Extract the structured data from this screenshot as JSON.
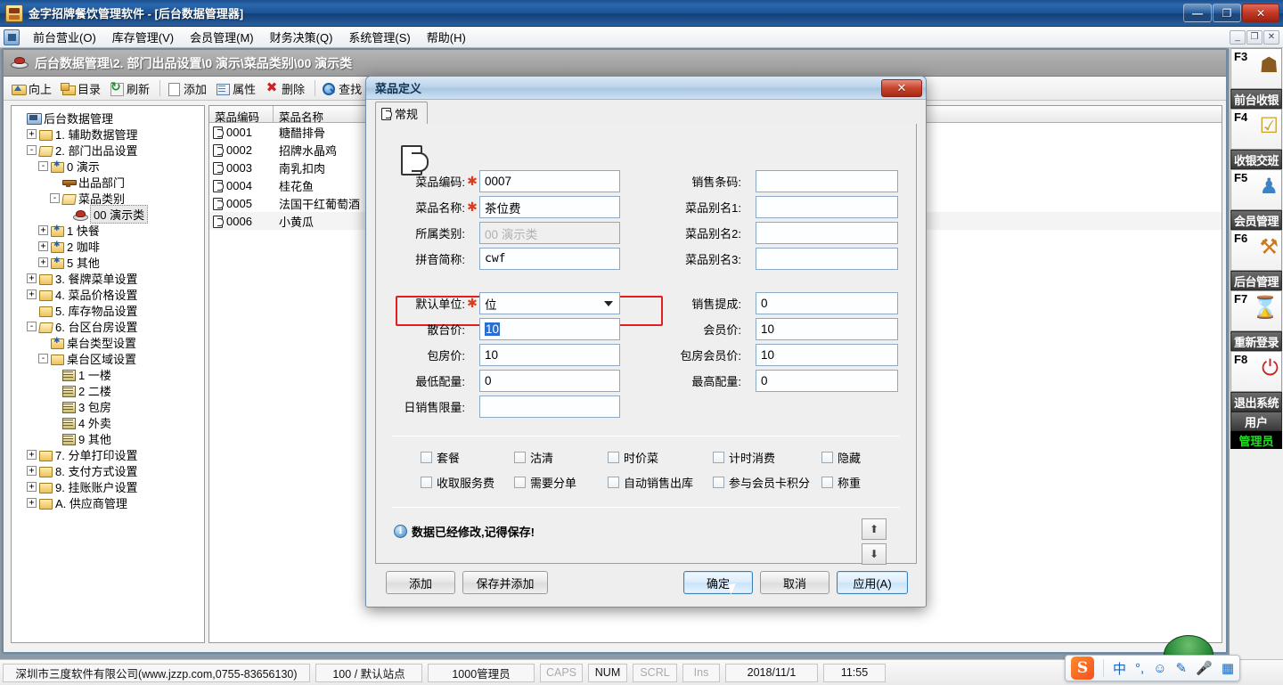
{
  "window": {
    "title": "金字招牌餐饮管理软件 - [后台数据管理器]",
    "minimize": "—",
    "maximize": "❐",
    "close": "✕",
    "mdi_minimize": "_",
    "mdi_restore": "❐",
    "mdi_close": "✕"
  },
  "menubar": {
    "items": [
      {
        "label": "前台营业(O)"
      },
      {
        "label": "库存管理(V)"
      },
      {
        "label": "会员管理(M)"
      },
      {
        "label": "财务决策(Q)"
      },
      {
        "label": "系统管理(S)"
      },
      {
        "label": "帮助(H)"
      }
    ]
  },
  "child": {
    "breadcrumb": "后台数据管理\\2. 部门出品设置\\0 演示\\菜品类别\\00 演示类",
    "toolbar": [
      {
        "label": "向上",
        "icon": "folder-up-icon"
      },
      {
        "label": "目录",
        "icon": "folder-icon"
      },
      {
        "label": "刷新",
        "icon": "refresh-icon"
      },
      {
        "label": "添加",
        "icon": "document-icon"
      },
      {
        "label": "属性",
        "icon": "properties-icon"
      },
      {
        "label": "删除",
        "icon": "delete-icon"
      },
      {
        "label": "查找",
        "icon": "search-icon"
      }
    ]
  },
  "tree": {
    "root": "后台数据管理",
    "nodes": [
      {
        "label": "1. 辅助数据管理",
        "depth": 1,
        "exp": "+",
        "icon": "folder"
      },
      {
        "label": "2. 部门出品设置",
        "depth": 1,
        "exp": "-",
        "icon": "folder-open"
      },
      {
        "label": "0 演示",
        "depth": 2,
        "exp": "-",
        "icon": "folder-star"
      },
      {
        "label": "出品部门",
        "depth": 3,
        "exp": "",
        "icon": "dept"
      },
      {
        "label": "菜品类别",
        "depth": 3,
        "exp": "-",
        "icon": "folder-open"
      },
      {
        "label": "00 演示类",
        "depth": 4,
        "exp": "",
        "icon": "dish",
        "selected": true
      },
      {
        "label": "1 快餐",
        "depth": 2,
        "exp": "+",
        "icon": "folder-star"
      },
      {
        "label": "2 咖啡",
        "depth": 2,
        "exp": "+",
        "icon": "folder-star"
      },
      {
        "label": "5 其他",
        "depth": 2,
        "exp": "+",
        "icon": "folder-star"
      },
      {
        "label": "3. 餐牌菜单设置",
        "depth": 1,
        "exp": "+",
        "icon": "folder"
      },
      {
        "label": "4. 菜品价格设置",
        "depth": 1,
        "exp": "+",
        "icon": "folder"
      },
      {
        "label": "5. 库存物品设置",
        "depth": 1,
        "exp": "",
        "icon": "folder"
      },
      {
        "label": "6. 台区台房设置",
        "depth": 1,
        "exp": "-",
        "icon": "folder-open"
      },
      {
        "label": "桌台类型设置",
        "depth": 2,
        "exp": "",
        "icon": "folder-star"
      },
      {
        "label": "桌台区域设置",
        "depth": 2,
        "exp": "-",
        "icon": "folder"
      },
      {
        "label": "1 一楼",
        "depth": 3,
        "exp": "",
        "icon": "table"
      },
      {
        "label": "2 二楼",
        "depth": 3,
        "exp": "",
        "icon": "table"
      },
      {
        "label": "3 包房",
        "depth": 3,
        "exp": "",
        "icon": "table"
      },
      {
        "label": "4 外卖",
        "depth": 3,
        "exp": "",
        "icon": "table"
      },
      {
        "label": "9 其他",
        "depth": 3,
        "exp": "",
        "icon": "table"
      },
      {
        "label": "7. 分单打印设置",
        "depth": 1,
        "exp": "+",
        "icon": "folder"
      },
      {
        "label": "8. 支付方式设置",
        "depth": 1,
        "exp": "+",
        "icon": "folder"
      },
      {
        "label": "9. 挂账账户设置",
        "depth": 1,
        "exp": "+",
        "icon": "folder"
      },
      {
        "label": "A. 供应商管理",
        "depth": 1,
        "exp": "+",
        "icon": "folder"
      }
    ]
  },
  "list": {
    "columns": [
      "菜品编码",
      "菜品名称"
    ],
    "rows": [
      {
        "code": "0001",
        "name": "糖醋排骨"
      },
      {
        "code": "0002",
        "name": "招牌水晶鸡"
      },
      {
        "code": "0003",
        "name": "南乳扣肉"
      },
      {
        "code": "0004",
        "name": "桂花鱼"
      },
      {
        "code": "0005",
        "name": "法国干红葡萄酒"
      },
      {
        "code": "0006",
        "name": "小黄瓜"
      }
    ]
  },
  "sidebar": {
    "items": [
      {
        "key": "F3",
        "label": "前台收银",
        "icon": "table-chairs-icon",
        "glyph": "☗"
      },
      {
        "key": "F4",
        "label": "收银交班",
        "icon": "clipboard-check-icon",
        "glyph": "☑"
      },
      {
        "key": "F5",
        "label": "会员管理",
        "icon": "members-icon",
        "glyph": "♟"
      },
      {
        "key": "F6",
        "label": "后台管理",
        "icon": "folder-tools-icon",
        "glyph": "⚒"
      },
      {
        "key": "F7",
        "label": "重新登录",
        "icon": "hourglass-icon",
        "glyph": "⌛"
      },
      {
        "key": "F8",
        "label": "退出系统",
        "icon": "power-icon",
        "glyph": "⏻"
      }
    ],
    "user_label": "用户",
    "user_value": "管理员"
  },
  "statusbar": {
    "company": "深圳市三度软件有限公司(www.jzzp.com,0755-83656130)",
    "station": "100 / 默认站点",
    "operator": "1000管理员",
    "caps": "CAPS",
    "num": "NUM",
    "scrl": "SCRL",
    "ins": "Ins",
    "date": "2018/11/1",
    "time": "11:55"
  },
  "ime": {
    "logo": "S",
    "lang": "中",
    "punct": "°,",
    "emoji": "☺",
    "pen": "✎",
    "mic": "Ἲ4",
    "apps": "☷"
  },
  "dialog": {
    "title": "菜品定义",
    "close": "✕",
    "tab": {
      "label": "常规",
      "icon": "dish-tab-icon"
    },
    "fields_left": [
      {
        "label": "菜品编码:",
        "required": true,
        "value": "0007",
        "name": "dish-code-input"
      },
      {
        "label": "菜品名称:",
        "required": true,
        "value": "茶位费",
        "name": "dish-name-input",
        "highlighted": true
      },
      {
        "label": "所属类别:",
        "required": false,
        "value": "00 演示类",
        "name": "dish-category-input",
        "readonly": true
      },
      {
        "label": "拼音简称:",
        "required": false,
        "value": "cwf",
        "name": "dish-pinyin-input",
        "mono": true
      }
    ],
    "fields_right": [
      {
        "label": "销售条码:",
        "value": "",
        "name": "sale-barcode-input"
      },
      {
        "label": "菜品别名1:",
        "value": "",
        "name": "dish-alias1-input"
      },
      {
        "label": "菜品别名2:",
        "value": "",
        "name": "dish-alias2-input"
      },
      {
        "label": "菜品别名3:",
        "value": "",
        "name": "dish-alias3-input"
      }
    ],
    "price_left": [
      {
        "label": "默认单位:",
        "required": true,
        "value": "位",
        "name": "default-unit-select",
        "type": "combo"
      },
      {
        "label": "散台价:",
        "required": false,
        "value": "10",
        "name": "table-price-input",
        "selected": true
      },
      {
        "label": "包房价:",
        "required": false,
        "value": "10",
        "name": "room-price-input"
      },
      {
        "label": "最低配量:",
        "required": false,
        "value": "0",
        "name": "min-qty-input"
      },
      {
        "label": "日销售限量:",
        "required": false,
        "value": "",
        "name": "daily-limit-input"
      }
    ],
    "price_right": [
      {
        "label": "销售提成:",
        "value": "0",
        "name": "commission-input"
      },
      {
        "label": "会员价:",
        "value": "10",
        "name": "member-price-input"
      },
      {
        "label": "包房会员价:",
        "value": "10",
        "name": "room-member-price-input"
      },
      {
        "label": "最高配量:",
        "value": "0",
        "name": "max-qty-input"
      }
    ],
    "checkboxes_row1": [
      {
        "label": "套餐",
        "checked": false,
        "name": "combo-meal-checkbox"
      },
      {
        "label": "沽清",
        "checked": false,
        "name": "sold-out-checkbox"
      },
      {
        "label": "时价菜",
        "checked": false,
        "name": "market-price-checkbox"
      },
      {
        "label": "计时消费",
        "checked": false,
        "name": "timed-consumption-checkbox"
      },
      {
        "label": "隐藏",
        "checked": false,
        "name": "hidden-checkbox"
      }
    ],
    "checkboxes_row2": [
      {
        "label": "收取服务费",
        "checked": false,
        "name": "service-fee-checkbox"
      },
      {
        "label": "需要分单",
        "checked": false,
        "name": "split-order-checkbox"
      },
      {
        "label": "自动销售出库",
        "checked": false,
        "name": "auto-stock-out-checkbox"
      },
      {
        "label": "参与会员卡积分",
        "checked": false,
        "name": "member-points-checkbox"
      },
      {
        "label": "称重",
        "checked": false,
        "name": "weighing-checkbox"
      }
    ],
    "message": "数据已经修改,记得保存!",
    "spin_up": "⬆",
    "spin_down": "⬇",
    "buttons": {
      "add": "添加",
      "save_and_add": "保存并添加",
      "ok": "确定",
      "cancel": "取消",
      "apply": "应用(A)"
    }
  },
  "colors": {
    "accent": "#2a68ad",
    "highlight": "#e02020",
    "required": "#e03a1a",
    "selection": "#2a6fd0",
    "user_value": "#22dd22"
  }
}
